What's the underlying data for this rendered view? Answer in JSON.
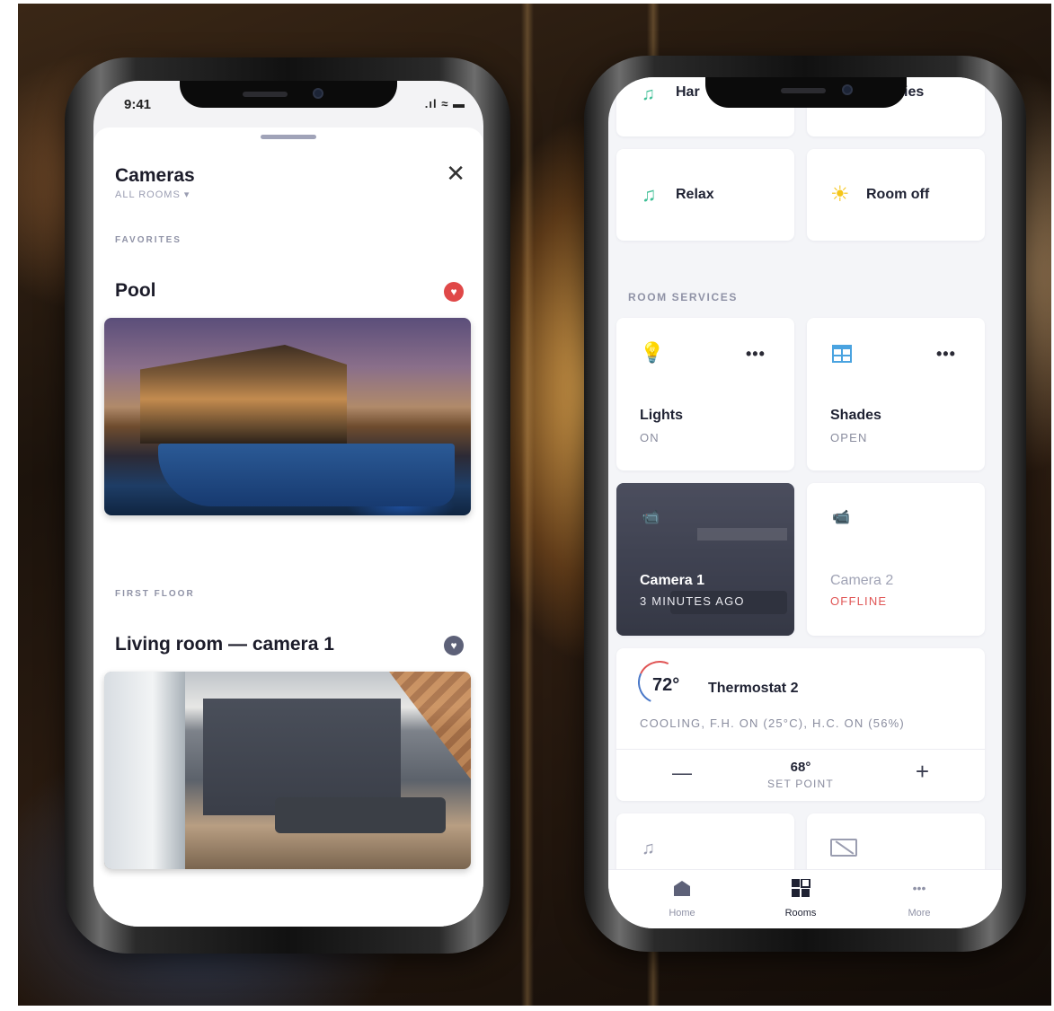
{
  "left_phone": {
    "status": {
      "time": "9:41",
      "icons": ".ıl ≈ ▬"
    },
    "sheet": {
      "title": "Cameras",
      "subtitle": "ALL ROOMS ▾",
      "close_label": "✕"
    },
    "sections": [
      {
        "label": "FAVORITES",
        "camera": {
          "title": "Pool",
          "favorite": true,
          "favorite_color": "#e04848"
        }
      },
      {
        "label": "FIRST FLOOR",
        "camera": {
          "title": "Living room — camera 1",
          "favorite": false,
          "favorite_color": "#5d6178"
        }
      }
    ]
  },
  "right_phone": {
    "top_partial": {
      "left": "Har",
      "right": "ies"
    },
    "scenes": [
      {
        "label": "Relax",
        "icon": "music-note-icon"
      },
      {
        "label": "Room off",
        "icon": "sun-icon"
      }
    ],
    "room_services_label": "ROOM SERVICES",
    "services": [
      {
        "label": "Lights",
        "status": "ON",
        "icon": "bulb-icon",
        "more": "•••"
      },
      {
        "label": "Shades",
        "status": "OPEN",
        "icon": "shades-icon",
        "more": "•••"
      },
      {
        "label": "Camera 1",
        "status": "3 MINUTES AGO",
        "icon": "camera-icon"
      },
      {
        "label": "Camera 2",
        "status": "OFFLINE",
        "icon": "camera-icon"
      }
    ],
    "thermostat": {
      "temp": "72°",
      "label": "Thermostat 2",
      "detail": "COOLING, F.H. ON (25°C), H.C. ON (56%)",
      "decrease": "—",
      "setpoint": "68°",
      "setpoint_label": "SET POINT",
      "increase": "+"
    },
    "tabs": [
      {
        "label": "Home",
        "active": false
      },
      {
        "label": "Rooms",
        "active": true
      },
      {
        "label": "More",
        "active": false
      }
    ],
    "more_dots": "•••",
    "colors": {
      "accent_green": "#3fbf96",
      "accent_yellow": "#f5c518",
      "offline_red": "#e05555",
      "accent_blue": "#4aa3e0"
    }
  }
}
